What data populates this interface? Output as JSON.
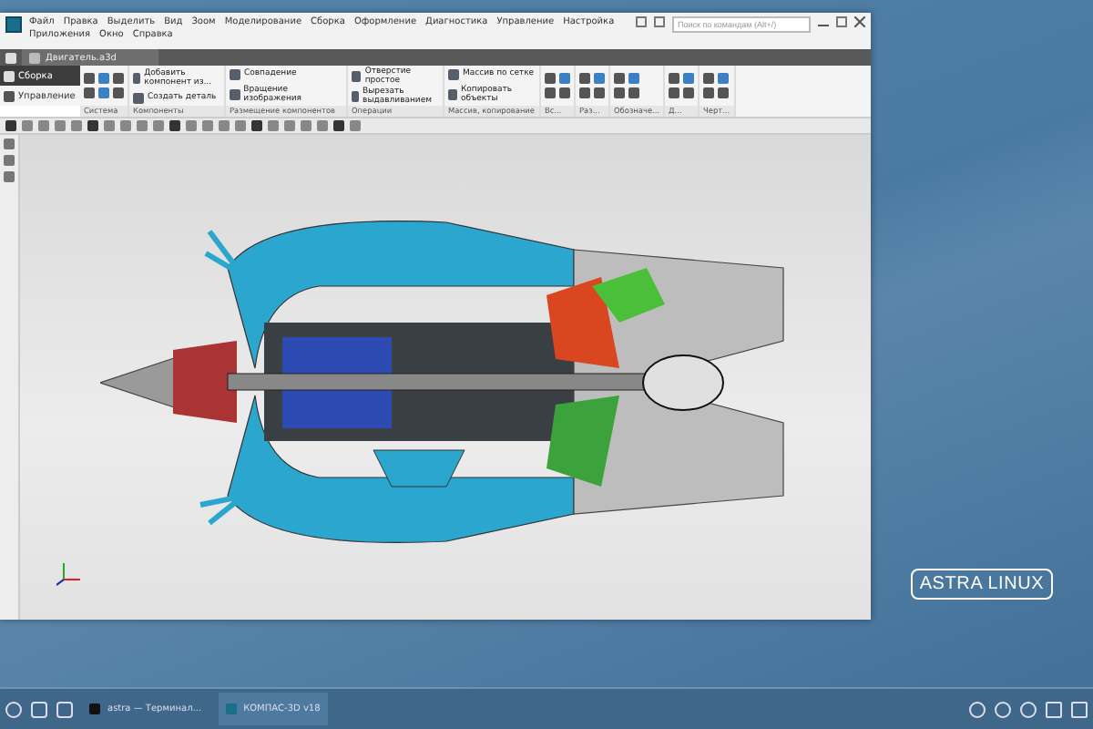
{
  "window": {
    "menu": [
      "Файл",
      "Правка",
      "Выделить",
      "Вид",
      "Зоом",
      "Моделирование",
      "Сборка",
      "Оформление",
      "Диагностика",
      "Управление",
      "Настройка",
      "Приложения",
      "Окно",
      "Справка"
    ],
    "search": {
      "placeholder": "Поиск по командам (Alt+/)"
    },
    "tabs": [
      {
        "label": "Двигатель.a3d",
        "selected": true
      }
    ],
    "left_panel": [
      {
        "label": "Сборка",
        "selected": true
      },
      {
        "label": "Управление",
        "selected": false
      }
    ],
    "ribbon_groups": [
      {
        "label": "Система"
      },
      {
        "label": "Компоненты",
        "buttons": [
          "Добавить компонент из...",
          "Создать деталь"
        ]
      },
      {
        "label": "Размещение компонентов",
        "buttons": [
          "Совпадение",
          "Вращение изображения"
        ]
      },
      {
        "label": "Операции",
        "buttons": [
          "Отверстие простое",
          "Вырезать выдавливанием"
        ]
      },
      {
        "label": "Массив, копирование",
        "buttons": [
          "Массив по сетке",
          "Копировать объекты"
        ]
      },
      {
        "label": "Вс..."
      },
      {
        "label": "Раз..."
      },
      {
        "label": "Обозначе..."
      },
      {
        "label": "Д..."
      },
      {
        "label": "Черт..."
      }
    ]
  },
  "taskbar": {
    "tasks": [
      {
        "label": "astra — Терминал...",
        "kind": "terminal",
        "selected": false
      },
      {
        "label": "КОМПАС-3D v18",
        "kind": "app",
        "selected": true
      }
    ]
  },
  "logo": {
    "text": "ASTRA LINUX"
  }
}
